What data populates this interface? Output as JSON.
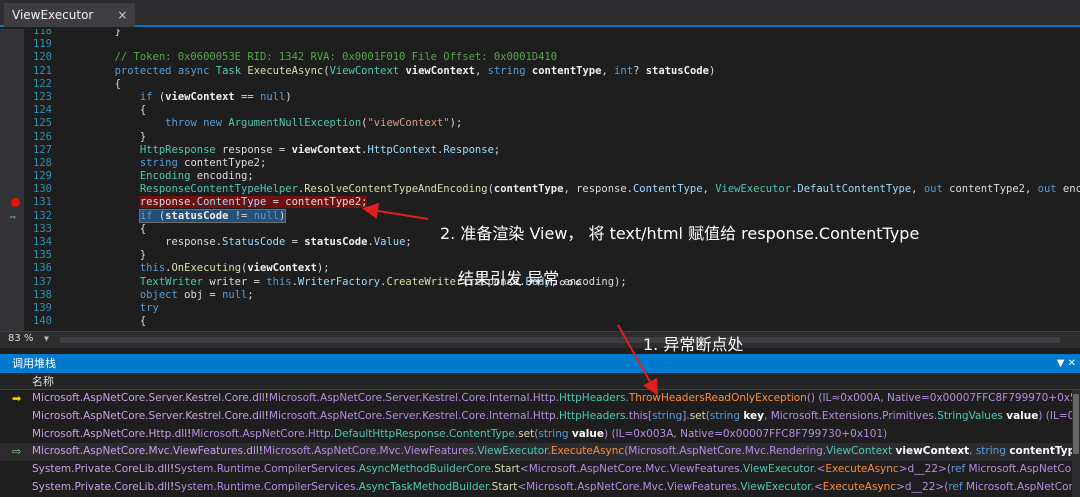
{
  "tab": {
    "title": "ViewExecutor",
    "close": "×"
  },
  "code_lines": [
    {
      "n": "118",
      "t": "        }"
    },
    {
      "n": "119",
      "t": ""
    },
    {
      "n": "120",
      "t": "        // Token: 0x0600053E RID: 1342 RVA: 0x0001F010 File Offset: 0x0001D410"
    },
    {
      "n": "121",
      "t": "        protected async Task ExecuteAsync(ViewContext viewContext, string contentType, int? statusCode)"
    },
    {
      "n": "122",
      "t": "        {"
    },
    {
      "n": "123",
      "t": "            if (viewContext == null)"
    },
    {
      "n": "124",
      "t": "            {"
    },
    {
      "n": "125",
      "t": "                throw new ArgumentNullException(\"viewContext\");"
    },
    {
      "n": "126",
      "t": "            }"
    },
    {
      "n": "127",
      "t": "            HttpResponse response = viewContext.HttpContext.Response;"
    },
    {
      "n": "128",
      "t": "            string contentType2;"
    },
    {
      "n": "129",
      "t": "            Encoding encoding;"
    },
    {
      "n": "130",
      "t": "            ResponseContentTypeHelper.ResolveContentTypeAndEncoding(contentType, response.ContentType, ViewExecutor.DefaultContentType, out contentType2, out encoding);"
    },
    {
      "n": "131",
      "t": "            response.ContentType = contentType2;"
    },
    {
      "n": "132",
      "t": "            if (statusCode != null)"
    },
    {
      "n": "133",
      "t": "            {"
    },
    {
      "n": "134",
      "t": "                response.StatusCode = statusCode.Value;"
    },
    {
      "n": "135",
      "t": "            }"
    },
    {
      "n": "136",
      "t": "            this.OnExecuting(viewContext);"
    },
    {
      "n": "137",
      "t": "            TextWriter writer = this.WriterFactory.CreateWriter(response.Body, encoding);"
    },
    {
      "n": "138",
      "t": "            object obj = null;"
    },
    {
      "n": "139",
      "t": "            try"
    },
    {
      "n": "140",
      "t": "            {"
    }
  ],
  "zoom": "83 %",
  "callstack": {
    "title": "调用堆栈",
    "column_name": "名称",
    "frames": [
      {
        "marker": "current",
        "text": "Microsoft.AspNetCore.Server.Kestrel.Core.dll!Microsoft.AspNetCore.Server.Kestrel.Core.Internal.Http.HttpHeaders.ThrowHeadersReadOnlyException() (IL≈0x000A, Native=0x00007FFC8F799970+0x54)"
      },
      {
        "marker": "",
        "text": "Microsoft.AspNetCore.Server.Kestrel.Core.dll!Microsoft.AspNetCore.Server.Kestrel.Core.Internal.Http.HttpHeaders.this[string].set(string key, Microsoft.Extensions.Primitives.StringValues value) (IL=0x000"
      },
      {
        "marker": "",
        "text": "Microsoft.AspNetCore.Http.dll!Microsoft.AspNetCore.Http.DefaultHttpResponse.ContentType.set(string value) (IL=0x003A, Native=0x00007FFC8F799730+0x101)"
      },
      {
        "marker": "selected",
        "text": "Microsoft.AspNetCore.Mvc.ViewFeatures.dll!Microsoft.AspNetCore.Mvc.ViewFeatures.ViewExecutor.ExecuteAsync(Microsoft.AspNetCore.Mvc.Rendering.ViewContext viewContext, string contentType, in"
      },
      {
        "marker": "",
        "text": "System.Private.CoreLib.dll!System.Runtime.CompilerServices.AsyncMethodBuilderCore.Start<Microsoft.AspNetCore.Mvc.ViewFeatures.ViewExecutor.<ExecuteAsync>d__22>(ref Microsoft.AspNetCore.Mv"
      },
      {
        "marker": "",
        "text": "System.Private.CoreLib.dll!System.Runtime.CompilerServices.AsyncTaskMethodBuilder.Start<Microsoft.AspNetCore.Mvc.ViewFeatures.ViewExecutor.<ExecuteAsync>d__22>(ref Microsoft.AspNetCore.Mv"
      }
    ]
  },
  "annotations": {
    "a1": "2. 准备渲染 View， 将 text/html 赋值给 response.ContentType",
    "a2": "结果引发 异常。。。",
    "a3": "1. 异常断点处"
  },
  "colors": {
    "accent": "#007acc",
    "breakpoint": "#e51400",
    "annotation_arrow": "#e02020"
  }
}
